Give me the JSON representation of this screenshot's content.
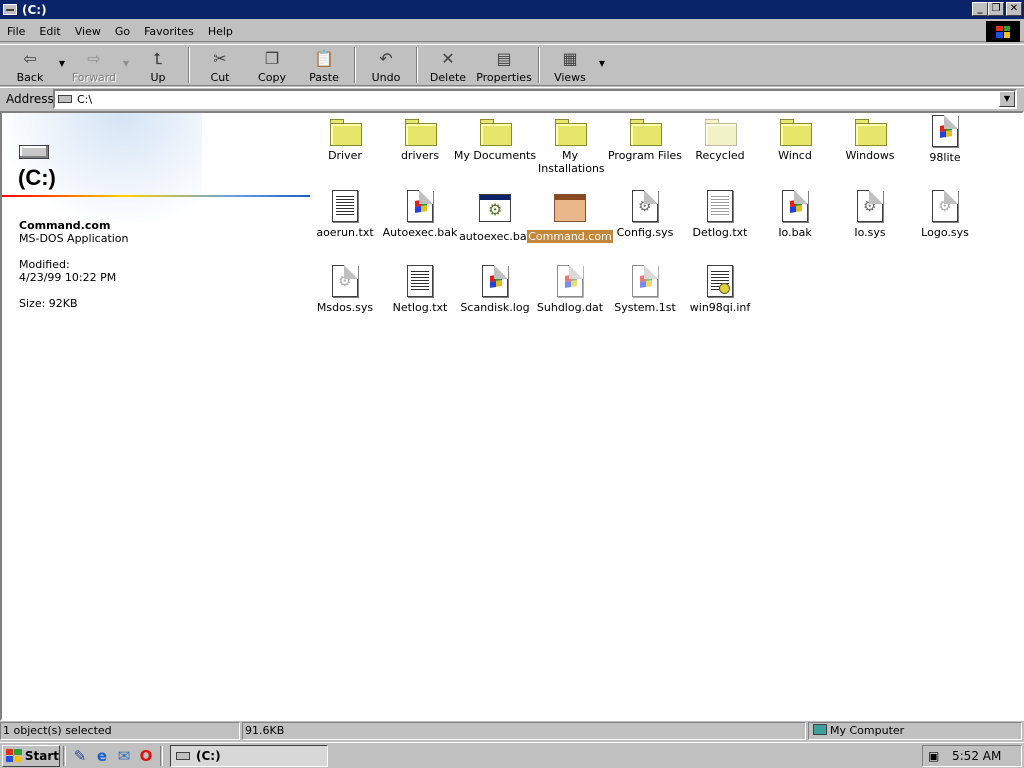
{
  "window": {
    "title": "(C:)"
  },
  "menu": [
    "File",
    "Edit",
    "View",
    "Go",
    "Favorites",
    "Help"
  ],
  "toolbar": {
    "back": "Back",
    "forward": "Forward",
    "up": "Up",
    "cut": "Cut",
    "copy": "Copy",
    "paste": "Paste",
    "undo": "Undo",
    "delete": "Delete",
    "properties": "Properties",
    "views": "Views"
  },
  "address": {
    "label": "Address",
    "value": "C:\\"
  },
  "info": {
    "title": "(C:)",
    "selected_name": "Command.com",
    "selected_type": "MS-DOS Application",
    "modified_label": "Modified:",
    "modified_value": "4/23/99 10:22 PM",
    "size": "Size: 92KB"
  },
  "files": [
    {
      "name": "Driver",
      "icon": "folder-icon"
    },
    {
      "name": "drivers",
      "icon": "folder-icon"
    },
    {
      "name": "My Documents",
      "icon": "folder-icon"
    },
    {
      "name": "My Installations",
      "icon": "folder-icon"
    },
    {
      "name": "Program Files",
      "icon": "folder-icon"
    },
    {
      "name": "Recycled",
      "icon": "folder-icon"
    },
    {
      "name": "Wincd",
      "icon": "folder-icon"
    },
    {
      "name": "Windows",
      "icon": "folder-icon"
    },
    {
      "name": "98lite",
      "icon": "windows-file-icon"
    },
    {
      "name": "aoerun.txt",
      "icon": "text-file-icon"
    },
    {
      "name": "Autoexec.bak",
      "icon": "windows-file-icon"
    },
    {
      "name": "autoexec.bat",
      "icon": "batch-file-icon"
    },
    {
      "name": "Command.com",
      "icon": "msdos-app-icon"
    },
    {
      "name": "Config.sys",
      "icon": "system-file-icon"
    },
    {
      "name": "Detlog.txt",
      "icon": "text-file-icon"
    },
    {
      "name": "Io.bak",
      "icon": "windows-file-icon"
    },
    {
      "name": "Io.sys",
      "icon": "system-file-icon"
    },
    {
      "name": "Logo.sys",
      "icon": "system-file-icon"
    },
    {
      "name": "Msdos.sys",
      "icon": "system-file-icon"
    },
    {
      "name": "Netlog.txt",
      "icon": "text-file-icon"
    },
    {
      "name": "Scandisk.log",
      "icon": "windows-file-icon"
    },
    {
      "name": "Suhdlog.dat",
      "icon": "windows-file-icon"
    },
    {
      "name": "System.1st",
      "icon": "windows-file-icon"
    },
    {
      "name": "win98qi.inf",
      "icon": "setup-info-file-icon"
    }
  ],
  "status": {
    "selection": "1 object(s) selected",
    "size": "91.6KB",
    "location": "My Computer"
  },
  "taskbar": {
    "start": "Start",
    "window": "(C:)",
    "clock": "5:52 AM"
  },
  "colors": {
    "title_bar": "#0a246a",
    "selection": "#c2873b",
    "desktop_gray": "#c0c0c0"
  }
}
